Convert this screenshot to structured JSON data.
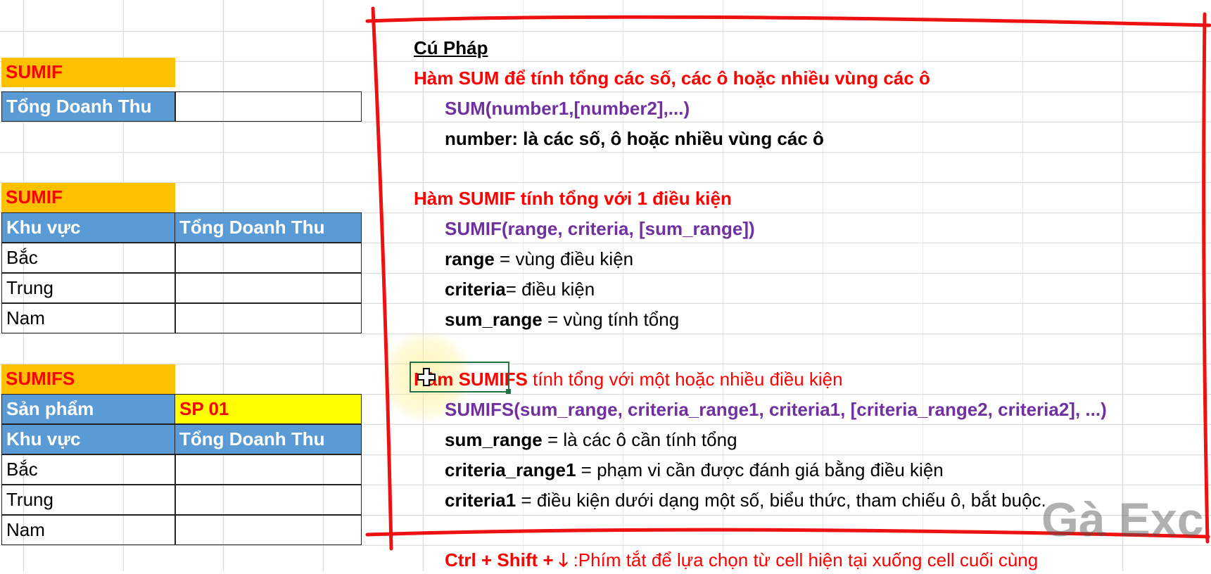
{
  "left": {
    "sumif1": {
      "header": "SUMIF",
      "label": "Tổng Doanh Thu"
    },
    "sumif2": {
      "header": "SUMIF",
      "col1": "Khu vực",
      "col2": "Tổng Doanh Thu",
      "rows": [
        "Bắc",
        "Trung",
        "Nam"
      ]
    },
    "sumifs": {
      "header": "SUMIFS",
      "product_label": "Sản phẩm",
      "product_value": "SP 01",
      "col1": "Khu vực",
      "col2": "Tổng Doanh Thu",
      "rows": [
        "Bắc",
        "Trung",
        "Nam"
      ]
    }
  },
  "right": {
    "syntax_title": "Cú Pháp",
    "sum": {
      "title": "Hàm SUM để tính tổng các số, các ô hoặc nhiều vùng các ô",
      "syntax": "SUM(number1,[number2],...)",
      "arg": "number: là các số, ô hoặc nhiều vùng các ô"
    },
    "sumif": {
      "title": "Hàm SUMIF tính tổng với 1 điều kiện",
      "syntax": "SUMIF(range, criteria, [sum_range])",
      "arg1_name": "range",
      "arg1_desc": " = vùng điều kiện",
      "arg2_name": "criteria",
      "arg2_desc": "= điều kiện",
      "arg3_name": "sum_range",
      "arg3_desc": " = vùng tính tổng"
    },
    "sumifs": {
      "title_bold": "Hàm SUMIFS",
      "title_rest": " tính tổng với một hoặc nhiều điều kiện",
      "syntax": "SUMIFS(sum_range, criteria_range1, criteria1, [criteria_range2, criteria2], ...)",
      "arg1_name": "sum_range",
      "arg1_desc": " = là các ô cần tính tổng",
      "arg2_name": "criteria_range1",
      "arg2_desc": " = phạm vi cần được đánh giá bằng điều kiện",
      "arg3_name": "criteria1",
      "arg3_desc": " = điều kiện dưới dạng một số, biểu thức, tham chiếu ô, bắt buộc."
    },
    "shortcut_keys": "Ctrl + Shift + ",
    "shortcut_arrow": "🡓",
    "shortcut_desc": " :Phím tắt để lựa chọn từ cell hiện tại  xuống cell cuối cùng"
  },
  "watermark": "Gà Exc",
  "colors": {
    "header_orange": "#ffc000",
    "header_blue": "#5b9bd5",
    "highlight_yellow": "#ffff00",
    "title_red": "#ff0000",
    "syntax_purple": "#7030a0",
    "annotation_red": "#ee1111"
  }
}
